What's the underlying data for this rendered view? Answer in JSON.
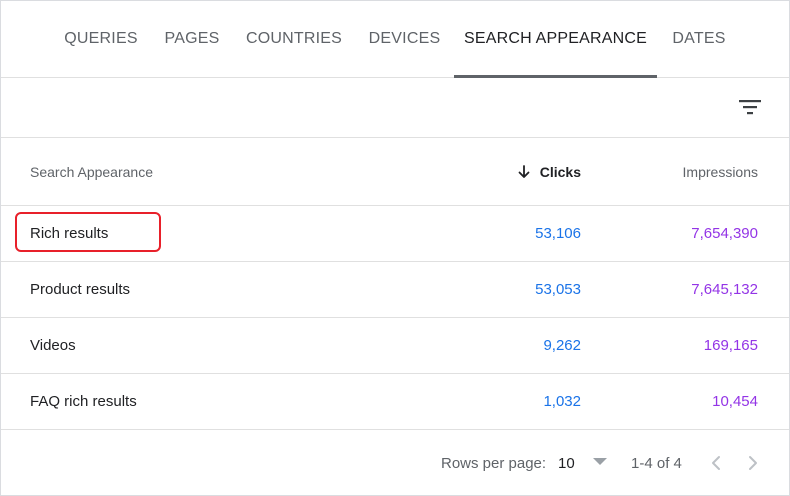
{
  "tabs": [
    {
      "label": "QUERIES",
      "active": false
    },
    {
      "label": "PAGES",
      "active": false
    },
    {
      "label": "COUNTRIES",
      "active": false
    },
    {
      "label": "DEVICES",
      "active": false
    },
    {
      "label": "SEARCH APPEARANCE",
      "active": true
    },
    {
      "label": "DATES",
      "active": false
    }
  ],
  "toolbar": {
    "filter_icon": "filter-list-icon"
  },
  "table": {
    "columns": {
      "name": "Search Appearance",
      "clicks": "Clicks",
      "impressions": "Impressions"
    },
    "sort": {
      "column": "clicks",
      "direction": "descending",
      "icon": "arrow-down-icon"
    },
    "rows": [
      {
        "name": "Rich results",
        "clicks": "53,106",
        "impressions": "7,654,390"
      },
      {
        "name": "Product results",
        "clicks": "53,053",
        "impressions": "7,645,132"
      },
      {
        "name": "Videos",
        "clicks": "9,262",
        "impressions": "169,165"
      },
      {
        "name": "FAQ rich results",
        "clicks": "1,032",
        "impressions": "10,454"
      }
    ]
  },
  "pagination": {
    "rows_per_page_label": "Rows per page:",
    "rows_per_page_value": "10",
    "range": "1-4 of 4"
  },
  "colors": {
    "clicks": "#1a73e8",
    "impressions": "#9334e6",
    "highlight": "#e8202a"
  }
}
